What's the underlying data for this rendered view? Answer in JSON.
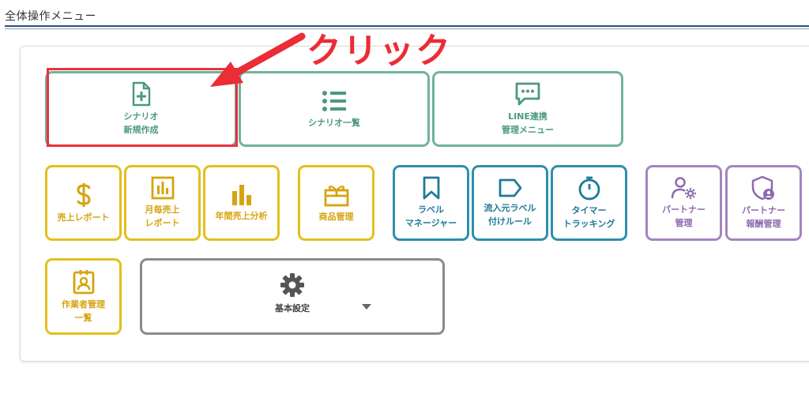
{
  "page": {
    "title": "全体操作メニュー"
  },
  "annotation": {
    "text": "クリック",
    "color": "#ec2c36"
  },
  "colors": {
    "green": "#6fb39a",
    "yellow": "#e3bf1d",
    "blue": "#2e8fae",
    "purple": "#a386bf",
    "gray": "#8a8a8a"
  },
  "menu": {
    "scenario_new": {
      "line1": "シナリオ",
      "line2": "新規作成",
      "icon": "file-plus-icon"
    },
    "scenario_list": {
      "line1": "シナリオ一覧",
      "icon": "list-icon"
    },
    "line_menu": {
      "line1": "LINE連携",
      "line2": "管理メニュー",
      "icon": "chat-icon"
    },
    "sales_report": {
      "line1": "売上レポート",
      "icon": "dollar-icon"
    },
    "monthly_report": {
      "line1": "月毎売上",
      "line2": "レポート",
      "icon": "bar-chart-box-icon"
    },
    "annual_analysis": {
      "line1": "年間売上分析",
      "icon": "bar-chart-icon"
    },
    "product_mgmt": {
      "line1": "商品管理",
      "icon": "gift-icon"
    },
    "label_manager": {
      "line1": "ラベル",
      "line2": "マネージャー",
      "icon": "bookmark-icon"
    },
    "inflow_label": {
      "line1": "流入元ラベル",
      "line2": "付けルール",
      "icon": "tag-icon"
    },
    "timer_tracking": {
      "line1": "タイマー",
      "line2": "トラッキング",
      "icon": "stopwatch-icon"
    },
    "partner_mgmt": {
      "line1": "パートナー",
      "line2": "管理",
      "icon": "user-gear-icon"
    },
    "partner_reward": {
      "line1": "パートナー",
      "line2": "報酬管理",
      "icon": "shield-user-icon"
    },
    "worker_list": {
      "line1": "作業者管理",
      "line2": "一覧",
      "icon": "id-badge-icon"
    },
    "basic_settings": {
      "line1": "基本設定",
      "icon": "gear-icon"
    }
  }
}
